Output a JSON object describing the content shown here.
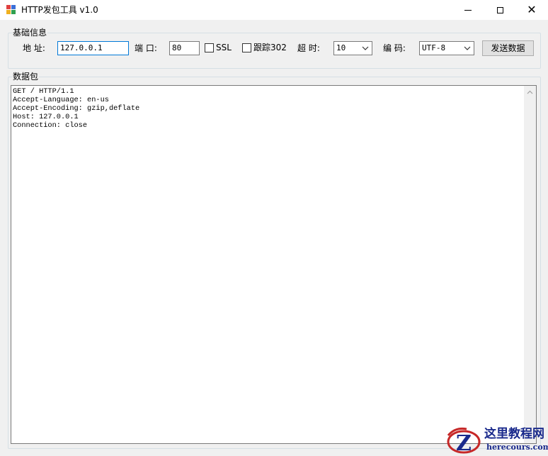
{
  "window": {
    "title": "HTTP发包工具 v1.0",
    "controls": {
      "minimize": "minimize",
      "maximize": "maximize",
      "close": "✕"
    }
  },
  "settings_group": {
    "legend": "基础信息",
    "address": {
      "label": "地 址:",
      "value": "127.0.0.1"
    },
    "port": {
      "label": "端 口:",
      "value": "80"
    },
    "ssl": {
      "label": "SSL",
      "checked": false
    },
    "follow_302": {
      "label": "跟踪302",
      "checked": false
    },
    "timeout": {
      "label": "超 时:",
      "selected": "10"
    },
    "encoding": {
      "label": "编 码:",
      "selected": "UTF-8"
    },
    "send_button": "发送数据"
  },
  "packet_group": {
    "legend": "数据包",
    "content": "GET / HTTP/1.1\nAccept-Language: en-us\nAccept-Encoding: gzip,deflate\nHost: 127.0.0.1\nConnection: close"
  },
  "watermark": {
    "title": "这里教程网",
    "url": "herecours.com",
    "logo_letter": "Z"
  },
  "colors": {
    "focus_border": "#0078d7",
    "window_bg": "#f0f0f0",
    "watermark_blue": "#1a2a8c",
    "watermark_red": "#c62828"
  }
}
